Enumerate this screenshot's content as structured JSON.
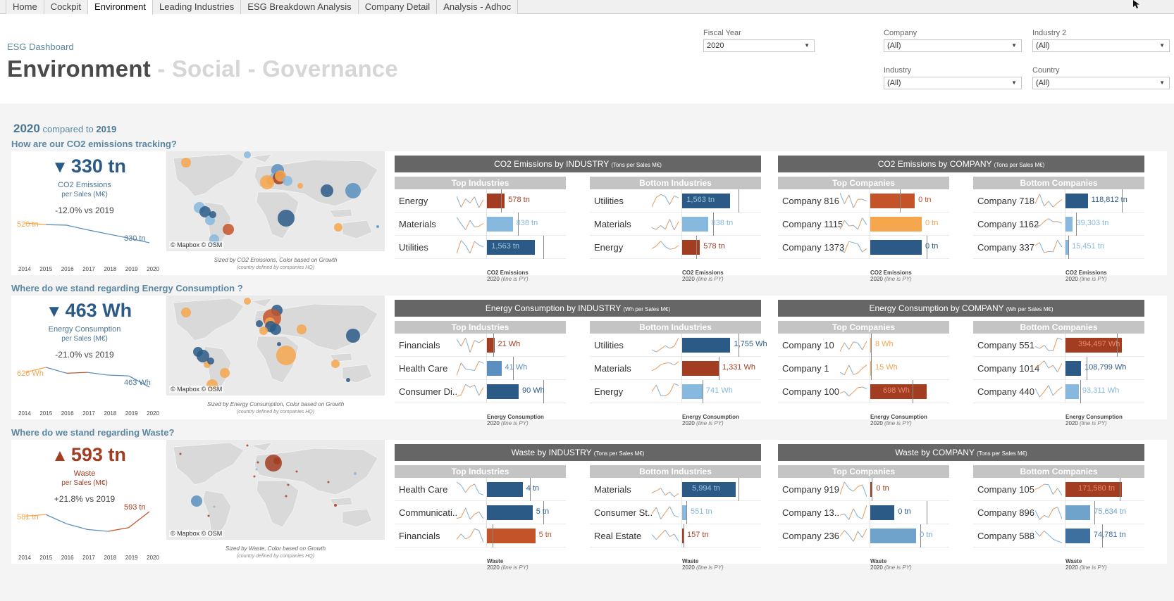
{
  "tabs": [
    {
      "label": "Home",
      "active": false
    },
    {
      "label": "Cockpit",
      "active": false
    },
    {
      "label": "Environment",
      "active": true
    },
    {
      "label": "Leading Industries",
      "active": false
    },
    {
      "label": "ESG Breakdown Analysis",
      "active": false
    },
    {
      "label": "Company Detail",
      "active": false
    },
    {
      "label": "Analysis - Adhoc",
      "active": false
    }
  ],
  "header": {
    "breadcrumb": "ESG Dashboard",
    "title_main": "Environment",
    "title_rest": " - Social - Governance"
  },
  "filters": {
    "fiscal_year": {
      "label": "Fiscal Year",
      "value": "2020"
    },
    "company": {
      "label": "Company",
      "value": "(All)"
    },
    "industry2": {
      "label": "Industry 2",
      "value": "(All)"
    },
    "industry": {
      "label": "Industry",
      "value": "(All)"
    },
    "country": {
      "label": "Country",
      "value": "(All)"
    }
  },
  "compare": {
    "year": "2020",
    "text": "compared to",
    "prev_year": "2019"
  },
  "colors": {
    "dark_blue": "#2c5a87",
    "mid_blue": "#5b8fbf",
    "light_blue": "#86b9dd",
    "orange": "#f6a64d",
    "dark_orange": "#c4532a",
    "rust": "#a23d22",
    "header_gray": "#666666",
    "subheader_gray": "#c4c4c4"
  },
  "years": [
    "2014",
    "2015",
    "2016",
    "2017",
    "2018",
    "2019",
    "2020"
  ],
  "sections": [
    {
      "question": "How are our CO2 emissions tracking?",
      "kpi": {
        "arrow": "▼",
        "value": "330 tn",
        "color": "#2c5a87",
        "metric": "CO2 Emissions",
        "per": "per Sales (M€)",
        "change": "-12.0%",
        "change_suffix": " vs 2019",
        "start_label": "520 tn",
        "end_label": "330 tn",
        "series": [
          520,
          505,
          500,
          455,
          415,
          375,
          330
        ]
      },
      "map": {
        "attribution": "© Mapbox  © OSM",
        "note": "Sized by CO2 Emissions, Color based on Growth",
        "note2": "(country defined by companies HQ)"
      },
      "industry": {
        "title": "CO2 Emissions by INDUSTRY",
        "unit": "(Tons per Sales M€)",
        "top_label": "Top Industries",
        "bottom_label": "Bottom Industries",
        "measure": "CO2 Emissions",
        "foot": "2020",
        "foot_note": "(line is PY)",
        "top": [
          {
            "name": "Energy",
            "value": "578 tn",
            "v": 578,
            "py": 450,
            "color": "#a23d22",
            "in": false
          },
          {
            "name": "Materials",
            "value": "838 tn",
            "v": 838,
            "py": 1000,
            "color": "#86b9dd",
            "in": false
          },
          {
            "name": "Utilities",
            "value": "1,563 tn",
            "v": 1563,
            "py": 1830,
            "color": "#2c5a87",
            "in": true
          }
        ],
        "bottom": [
          {
            "name": "Utilities",
            "value": "1,563 tn",
            "v": 1563,
            "py": 1830,
            "color": "#2c5a87",
            "in": true
          },
          {
            "name": "Materials",
            "value": "838 tn",
            "v": 838,
            "py": 1000,
            "color": "#86b9dd",
            "in": false
          },
          {
            "name": "Energy",
            "value": "578 tn",
            "v": 578,
            "py": 450,
            "color": "#a23d22",
            "in": false
          }
        ]
      },
      "company": {
        "title": "CO2 Emissions by COMPANY",
        "unit": "(Tons per Sales M€)",
        "top_label": "Top Companies",
        "bottom_label": "Bottom Companies",
        "measure": "CO2 Emissions",
        "foot": "2020",
        "foot_note": "(line is PY)",
        "top": [
          {
            "name": "Company 816",
            "value": "0 tn",
            "v": 0.45,
            "py": 0.3,
            "color": "#c4532a",
            "in": false
          },
          {
            "name": "Company 1115",
            "value": "0 tn",
            "v": 0.52,
            "py": null,
            "color": "#f6a64d",
            "in": false
          },
          {
            "name": "Company 1373",
            "value": "0 tn",
            "v": 0.52,
            "py": 0.57,
            "color": "#2c5a87",
            "in": false
          }
        ],
        "bottom": [
          {
            "name": "Company 718",
            "value": "118,812 tn",
            "v": 118812,
            "py": 300000,
            "color": "#2c5a87",
            "in": false
          },
          {
            "name": "Company 1162",
            "value": "39,303 tn",
            "v": 39303,
            "py": 55000,
            "color": "#86b9dd",
            "in": false
          },
          {
            "name": "Company 337",
            "value": "15,451 tn",
            "v": 15451,
            "py": 16000,
            "color": "#86b9dd",
            "in": false
          }
        ]
      }
    },
    {
      "question": "Where do we stand regarding Energy Consumption ?",
      "kpi": {
        "arrow": "▼",
        "value": "463 Wh",
        "color": "#2c5a87",
        "metric": "Energy Consumption",
        "per": "per Sales (M€)",
        "change": "-21.0%",
        "change_suffix": " vs 2019",
        "start_label": "626 Wh",
        "end_label": "463 Wh",
        "series": [
          626,
          680,
          615,
          625,
          595,
          586,
          463
        ]
      },
      "map": {
        "attribution": "© Mapbox  © OSM",
        "note": "Sized by Energy Consumption, Color based on Growth",
        "note2": "(country defined by companies HQ)"
      },
      "industry": {
        "title": "Energy Consumption by INDUSTRY",
        "unit": "(Wh per Sales M€)",
        "top_label": "Top Industries",
        "bottom_label": "Bottom Industries",
        "measure": "Energy Consumption",
        "foot": "2020",
        "foot_note": "(line is PY)",
        "top": [
          {
            "name": "Financials",
            "value": "21 Wh",
            "v": 21,
            "py": 17,
            "color": "#a23d22",
            "in": false
          },
          {
            "name": "Health Care",
            "value": "41 Wh",
            "v": 41,
            "py": 74,
            "color": "#5b8fbf",
            "in": false
          },
          {
            "name": "Consumer Di..",
            "value": "90 Wh",
            "v": 90,
            "py": 160,
            "color": "#2c5a87",
            "in": false
          }
        ],
        "bottom": [
          {
            "name": "Utilities",
            "value": "1,755 Wh",
            "v": 1755,
            "py": 2050,
            "color": "#2c5a87",
            "in": false
          },
          {
            "name": "Materials",
            "value": "1,331 Wh",
            "v": 1331,
            "py": 1330,
            "color": "#a23d22",
            "in": false
          },
          {
            "name": "Energy",
            "value": "741 Wh",
            "v": 741,
            "py": 740,
            "color": "#86b9dd",
            "in": false
          }
        ]
      },
      "company": {
        "title": "Energy Consumption by COMPANY",
        "unit": "(Wh per Sales M€)",
        "top_label": "Top Companies",
        "bottom_label": "Bottom Companies",
        "measure": "Energy Consumption",
        "foot": "2020",
        "foot_note": "(line is PY)",
        "top": [
          {
            "name": "Company 10",
            "value": "8 Wh",
            "v": 8,
            "py": 10,
            "color": "#f6a64d",
            "in": false
          },
          {
            "name": "Company 1",
            "value": "15 Wh",
            "v": 15,
            "py": 10,
            "color": "#f6a64d",
            "in": false
          },
          {
            "name": "Company 100",
            "value": "698 Wh",
            "v": 698,
            "py": 520,
            "color": "#a23d22",
            "in": true
          }
        ],
        "bottom": [
          {
            "name": "Company 551",
            "value": "394,497 Wh",
            "v": 394497,
            "py": 360000,
            "color": "#a23d22",
            "in": true
          },
          {
            "name": "Company 1014",
            "value": "108,799 Wh",
            "v": 108799,
            "py": 150000,
            "color": "#2c5a87",
            "in": false
          },
          {
            "name": "Company 440",
            "value": "93,311 Wh",
            "v": 93311,
            "py": 105000,
            "color": "#86b9dd",
            "in": false
          }
        ]
      }
    },
    {
      "question": "Where do we stand regarding Waste?",
      "kpi": {
        "arrow": "▲",
        "value": "593 tn",
        "color": "#a23d22",
        "metric": "Waste",
        "per": "per Sales (M€)",
        "change": "+21.8%",
        "change_suffix": " vs 2019",
        "start_label": "581 tn",
        "end_label": "593 tn",
        "series": [
          581,
          585,
          560,
          545,
          540,
          550,
          593
        ]
      },
      "map": {
        "attribution": "© Mapbox  © OSM",
        "note": "Sized by Waste, Color based on Growth",
        "note2": "(country defined by companies HQ)"
      },
      "industry": {
        "title": "Waste by INDUSTRY",
        "unit": "(Tons per Sales M€)",
        "top_label": "Top Industries",
        "bottom_label": "Bottom Industries",
        "measure": "Waste",
        "foot": "2020",
        "foot_note": "(line is PY)",
        "top": [
          {
            "name": "Health Care",
            "value": "4 tn",
            "v": 4,
            "py": 4.8,
            "color": "#2c5a87",
            "in": false
          },
          {
            "name": "Communicati..",
            "value": "5 tn",
            "v": 5.1,
            "py": 6.3,
            "color": "#2c5a87",
            "in": false
          },
          {
            "name": "Financials",
            "value": "5 tn",
            "v": 5.4,
            "py": 0.6,
            "color": "#c4532a",
            "in": false
          }
        ],
        "bottom": [
          {
            "name": "Materials",
            "value": "5,994 tn",
            "v": 5994,
            "py": 6300,
            "color": "#2c5a87",
            "in": true
          },
          {
            "name": "Consumer St..",
            "value": "551 tn",
            "v": 551,
            "py": 500,
            "color": "#86b9dd",
            "in": false
          },
          {
            "name": "Real Estate",
            "value": "157 tn",
            "v": 157,
            "py": 120,
            "color": "#a23d22",
            "in": false
          }
        ]
      },
      "company": {
        "title": "Waste by COMPANY",
        "unit": "(Tons per Sales M€)",
        "top_label": "Top Companies",
        "bottom_label": "Bottom Companies",
        "measure": "Waste",
        "foot": "2020",
        "foot_note": "(line is PY)",
        "top": [
          {
            "name": "Company 919",
            "value": "0 tn",
            "v": 0.03,
            "py": 0.02,
            "color": "#a23d22",
            "in": false
          },
          {
            "name": "Company 13..",
            "value": "0 tn",
            "v": 0.3,
            "py": 0.7,
            "color": "#2c5a87",
            "in": false
          },
          {
            "name": "Company 236",
            "value": "0 tn",
            "v": 0.57,
            "py": 0.62,
            "color": "#6fa3cc",
            "in": false
          }
        ],
        "bottom": [
          {
            "name": "Company 105",
            "value": "171,580 tn",
            "v": 171580,
            "py": 165000,
            "color": "#a23d22",
            "in": true
          },
          {
            "name": "Company 896",
            "value": "75,634 tn",
            "v": 75634,
            "py": 88000,
            "color": "#6fa3cc",
            "in": false
          },
          {
            "name": "Company 588",
            "value": "74,781 tn",
            "v": 74781,
            "py": 112000,
            "color": "#3d6f9f",
            "in": false
          }
        ]
      }
    }
  ]
}
